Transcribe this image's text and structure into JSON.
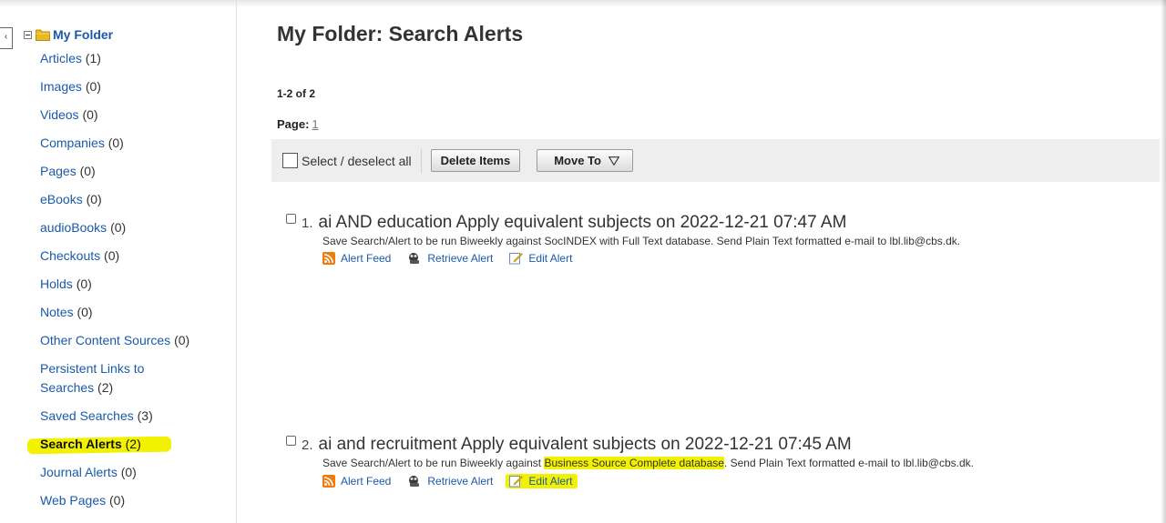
{
  "sidebar": {
    "collapse_glyph": "‹",
    "folder_title": "My Folder",
    "items": [
      {
        "label": "Articles",
        "count": "(1)"
      },
      {
        "label": "Images",
        "count": "(0)"
      },
      {
        "label": "Videos",
        "count": "(0)"
      },
      {
        "label": "Companies",
        "count": "(0)"
      },
      {
        "label": "Pages",
        "count": "(0)"
      },
      {
        "label": "eBooks",
        "count": "(0)"
      },
      {
        "label": "audioBooks",
        "count": "(0)"
      },
      {
        "label": "Checkouts",
        "count": "(0)"
      },
      {
        "label": "Holds",
        "count": "(0)"
      },
      {
        "label": "Notes",
        "count": "(0)"
      },
      {
        "label": "Other Content Sources",
        "count": "(0)"
      },
      {
        "label": "Persistent Links to Searches",
        "count": "(2)"
      },
      {
        "label": "Saved Searches",
        "count": "(3)"
      },
      {
        "label": "Search Alerts",
        "count": "(2)",
        "active": true
      },
      {
        "label": "Journal Alerts",
        "count": "(0)"
      },
      {
        "label": "Web Pages",
        "count": "(0)"
      }
    ]
  },
  "main": {
    "title": "My Folder: Search Alerts",
    "range": "1-2 of 2",
    "page_label": "Page:",
    "page_number": "1",
    "toolbar": {
      "select_all_label": "Select / deselect all",
      "delete_label": "Delete Items",
      "move_label": "Move To"
    },
    "results": [
      {
        "number": "1.",
        "title": "ai AND education Apply equivalent subjects on 2022-12-21 07:47 AM",
        "desc_before": "Save Search/Alert to be run Biweekly against ",
        "desc_db": "SocINDEX with Full Text database",
        "desc_after": ". Send Plain Text formatted e-mail to lbl.lib@cbs.dk.",
        "actions": {
          "feed": "Alert Feed",
          "retrieve": "Retrieve Alert",
          "edit": "Edit Alert"
        }
      },
      {
        "number": "2.",
        "title": "ai and recruitment Apply equivalent subjects on 2022-12-21 07:45 AM",
        "desc_before": "Save Search/Alert to be run Biweekly against ",
        "desc_db": "Business Source Complete database",
        "desc_after": ". Send Plain Text formatted e-mail to lbl.lib@cbs.dk.",
        "actions": {
          "feed": "Alert Feed",
          "retrieve": "Retrieve Alert",
          "edit": "Edit Alert"
        }
      }
    ]
  },
  "colors": {
    "link": "#1a5aa8",
    "highlight": "#f2f200",
    "toolbar_bg": "#eeeeee",
    "rss_orange": "#f07a10"
  },
  "icons": [
    "minus-box-icon",
    "folder-icon",
    "rss-feed-icon",
    "retrieve-alert-icon",
    "edit-alert-icon",
    "chevron-down-icon"
  ]
}
